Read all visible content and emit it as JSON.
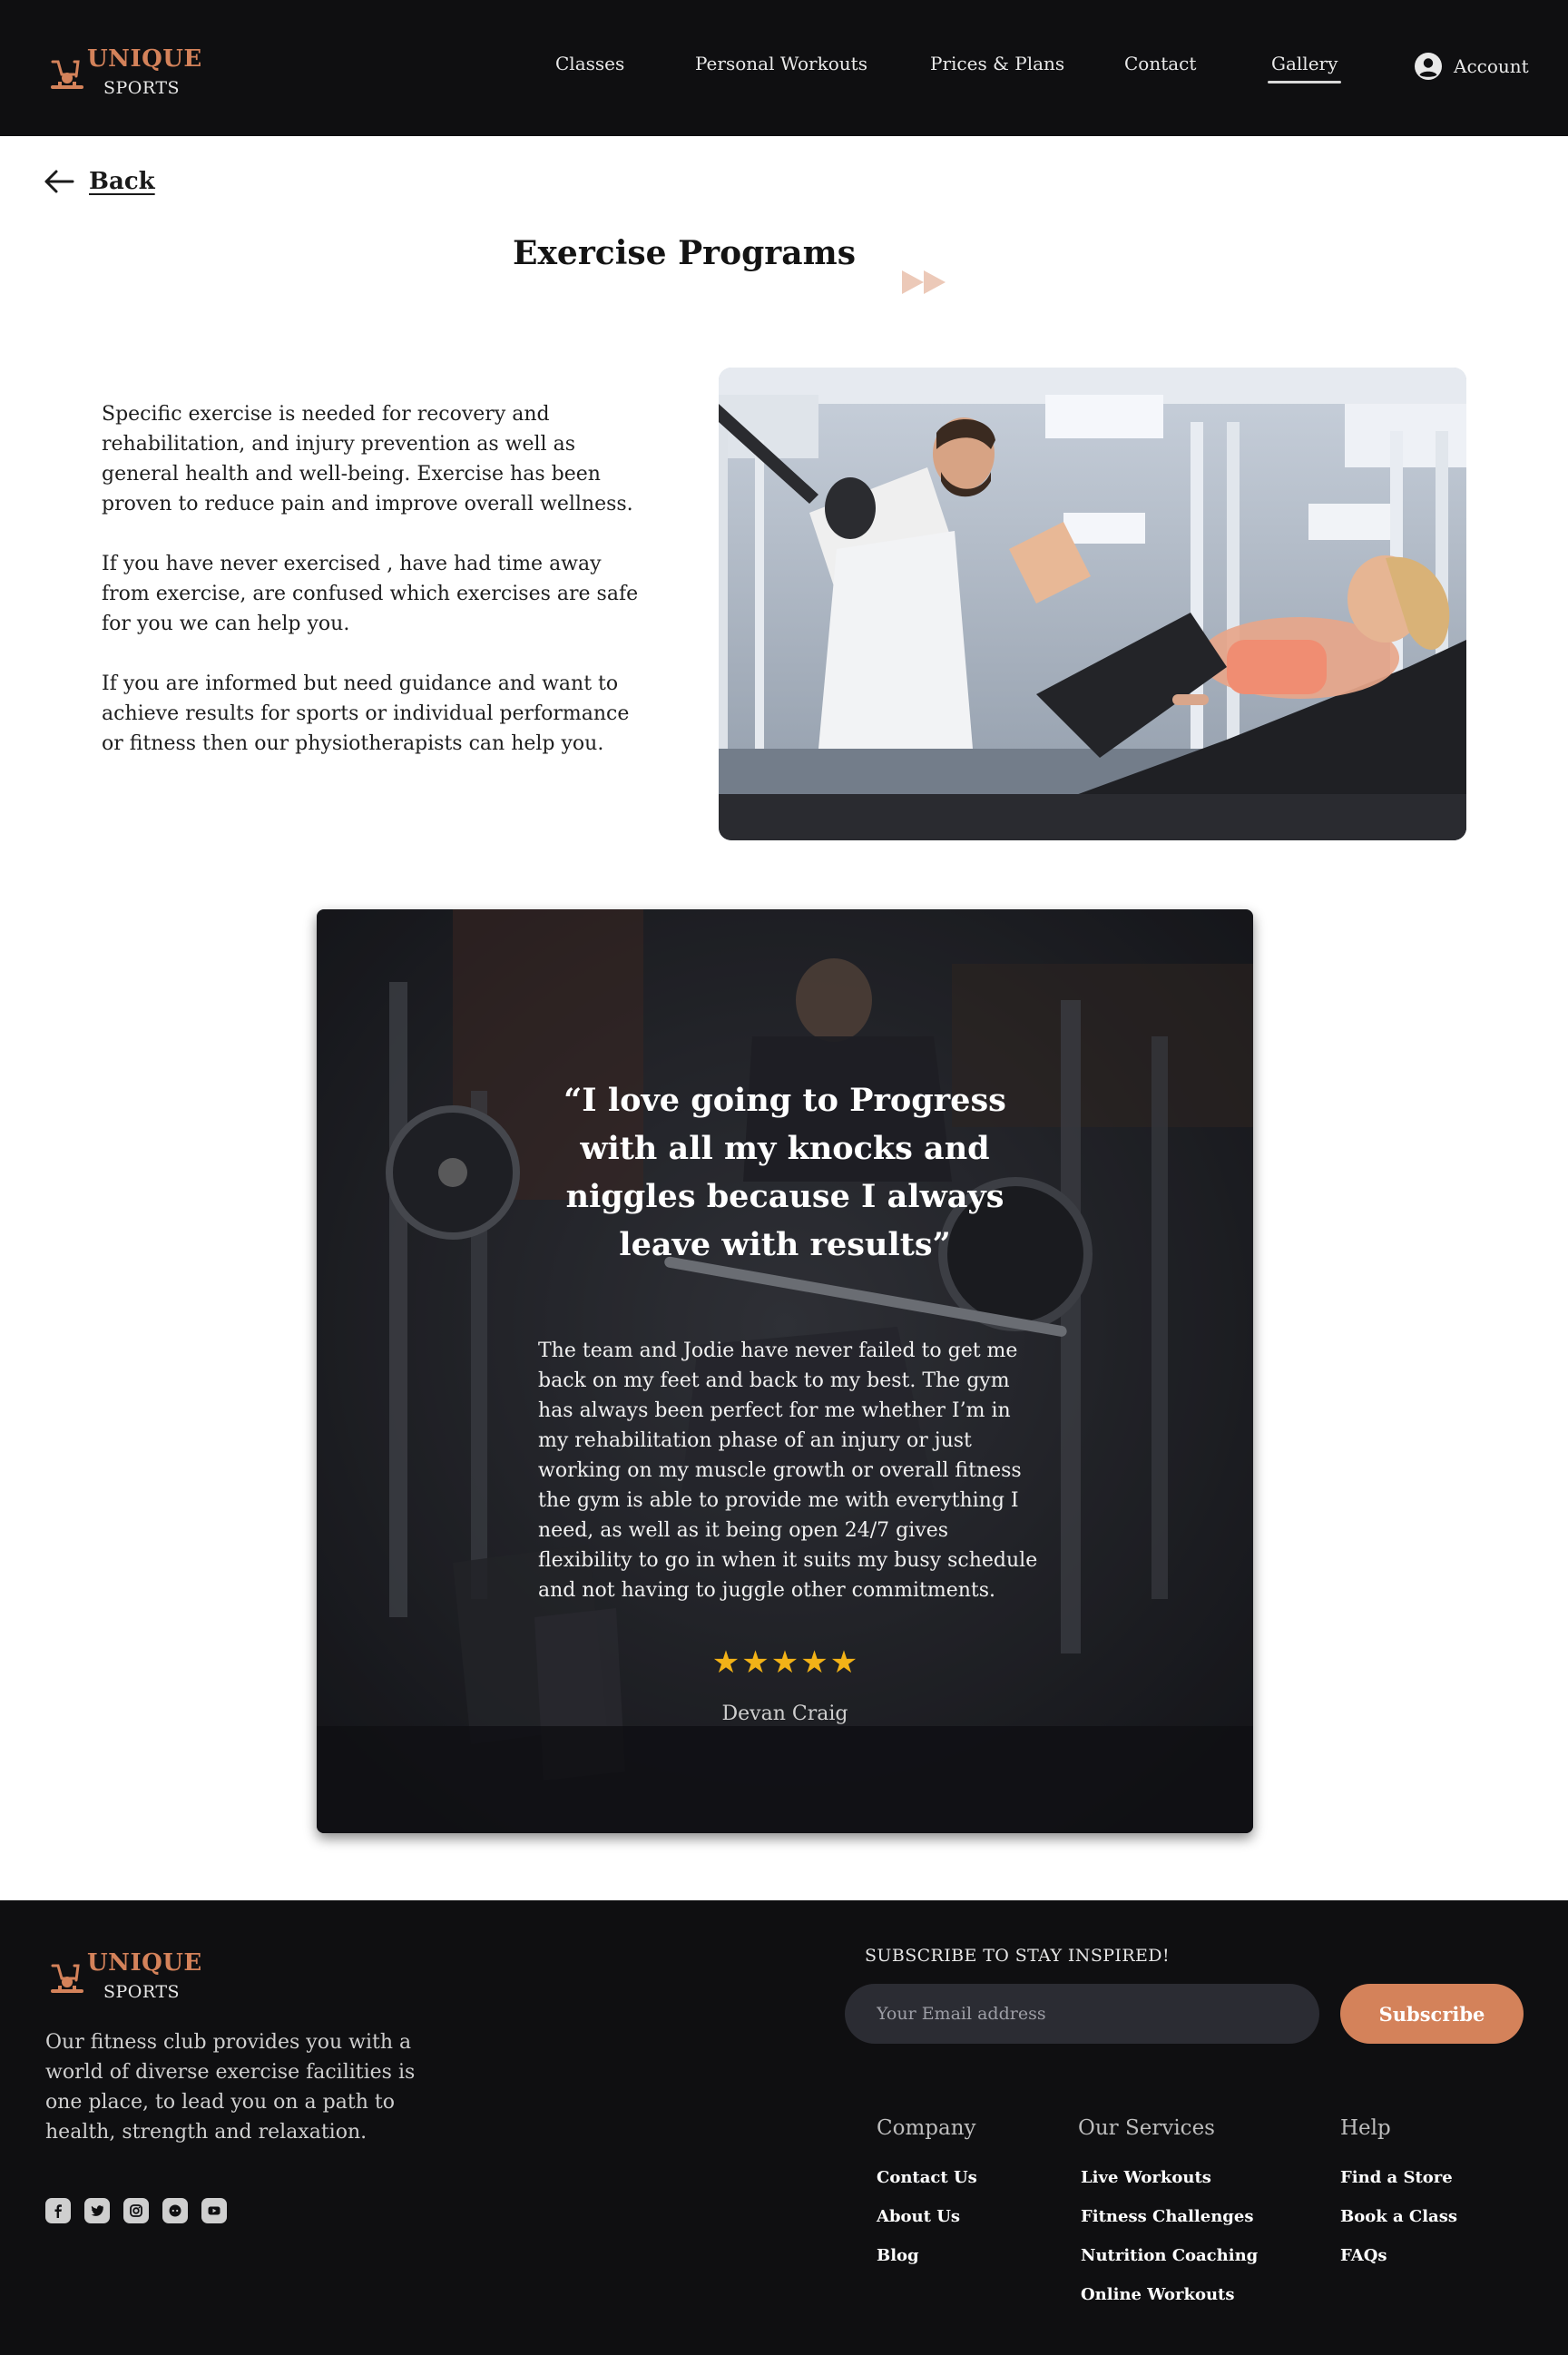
{
  "brand": {
    "name_line1": "UNIQUE",
    "name_line2": "SPORTS",
    "accent_color": "#d4825a",
    "dark_bg": "#0f0f11"
  },
  "nav": {
    "items": [
      {
        "label": "Classes"
      },
      {
        "label": "Personal Workouts"
      },
      {
        "label": "Prices & Plans"
      },
      {
        "label": "Contact"
      },
      {
        "label": "Gallery",
        "active": true
      }
    ],
    "account_label": "Account",
    "account_icon": "user-circle-icon"
  },
  "back": {
    "label": "Back",
    "icon": "arrow-left-icon"
  },
  "page": {
    "title": "Exercise Programs"
  },
  "intro": {
    "paragraphs": [
      "Specific exercise is needed for recovery and rehabilitation, and injury prevention as well as general health and well-being. Exercise has been proven to reduce pain and improve overall wellness.",
      "If you have never exercised , have had time away from exercise, are confused which exercises are safe for you we can help you.",
      "If you are informed but need guidance and want to achieve results for sports or individual performance or fitness then our physiotherapists can help you."
    ]
  },
  "testimonial": {
    "quote": "“I love going to Progress with all my knocks and niggles because I always leave with results”",
    "body": "The team and Jodie have never failed to get me back on my feet and back to my best. The gym has always been perfect for me whether I’m in my rehabilitation phase of an injury or just working on my muscle growth or overall fitness the gym is able to provide me with everything I need, as well as it being open 24/7 gives flexibility to go in when it suits my busy schedule and not having to juggle other commitments.",
    "rating": 5,
    "rating_max": 5,
    "star_color": "#f2b217",
    "reviewer": "Devan Craig"
  },
  "footer": {
    "description": "Our fitness club provides you with a world of diverse exercise facilities is one place, to lead you on a path to health, strength and relaxation.",
    "socials": [
      "facebook-icon",
      "twitter-icon",
      "instagram-icon",
      "discord-icon",
      "youtube-icon"
    ],
    "subscribe_title": "SUBSCRIBE TO STAY INSPIRED!",
    "email_placeholder": "Your Email address",
    "subscribe_label": "Subscribe",
    "columns": [
      {
        "heading": "Company",
        "links": [
          "Contact Us",
          "About Us",
          "Blog"
        ]
      },
      {
        "heading": "Our Services",
        "links": [
          "Live Workouts",
          "Fitness Challenges",
          "Nutrition Coaching",
          "Online Workouts"
        ]
      },
      {
        "heading": "Help",
        "links": [
          "Find a Store",
          "Book a Class",
          "FAQs"
        ]
      }
    ]
  }
}
